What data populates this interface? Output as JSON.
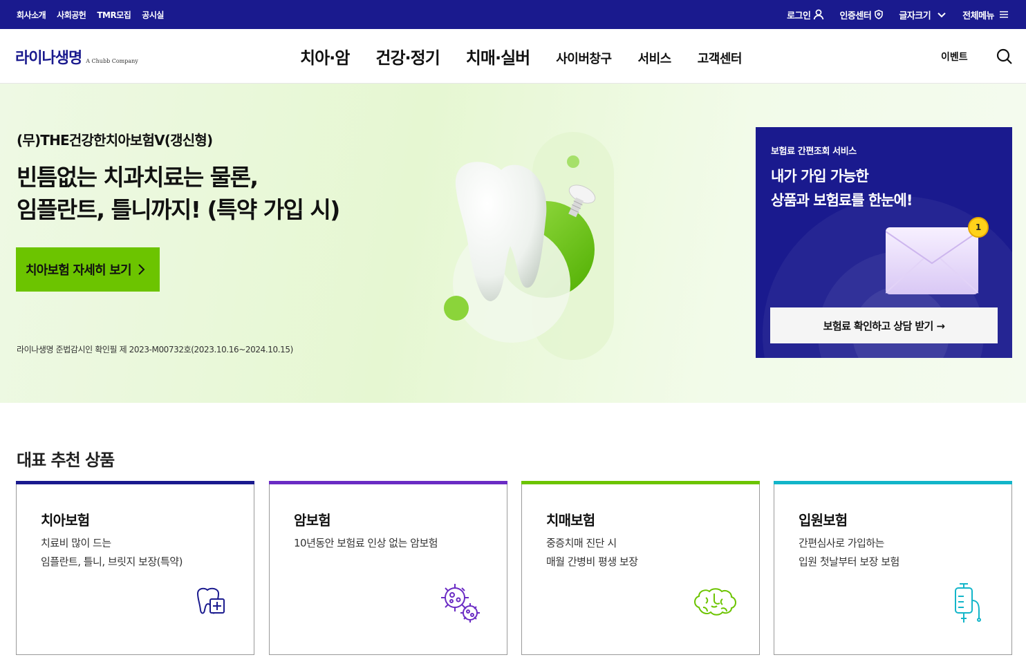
{
  "topbar": {
    "links": [
      "회사소개",
      "사회공헌",
      "TMR모집",
      "공시실"
    ],
    "login": "로그인",
    "auth_center": "인증센터",
    "font_size": "글자크기",
    "full_menu": "전체메뉴"
  },
  "header": {
    "logo": "라이나생명",
    "logo_sub": "A Chubb Company",
    "nav_big": [
      "치아·암",
      "건강·정기",
      "치매·실버"
    ],
    "nav_small": [
      "사이버창구",
      "서비스",
      "고객센터"
    ],
    "event": "이벤트"
  },
  "hero": {
    "product": "(무)THE건강한치아보험V(갱신형)",
    "title_line1": "빈틈없는 치과치료는 물론,",
    "title_line2": "임플란트, 틀니까지! (특약 가입 시)",
    "cta": "치아보험 자세히 보기",
    "note": "라이나생명 준법감시인 확인필 제 2023-M00732호(2023.10.16~2024.10.15)"
  },
  "panel": {
    "label": "보험료 간편조회 서비스",
    "title_line1": "내가 가입 가능한",
    "title_line2": "상품과 보험료를 한눈에!",
    "badge": "1",
    "button": "보험료 확인하고 상담 받기 →"
  },
  "section": {
    "title": "대표 추천 상품",
    "cards": [
      {
        "title": "치아보험",
        "line1": "치료비 많이 드는",
        "line2": "임플란트, 틀니, 브릿지 보장(특약)",
        "icon": "tooth-icon",
        "color": "#1a1a8e"
      },
      {
        "title": "암보험",
        "line1": "10년동안 보험료 인상 없는 암보험",
        "line2": "",
        "icon": "virus-icon",
        "color": "#6a2bc4"
      },
      {
        "title": "치매보험",
        "line1": "중증치매 진단 시",
        "line2": "매월 간병비 평생 보장",
        "icon": "brain-icon",
        "color": "#6cc400"
      },
      {
        "title": "입원보험",
        "line1": "간편심사로 가입하는",
        "line2": "입원 첫날부터 보장 보험",
        "icon": "iv-drip-icon",
        "color": "#12b5c9"
      }
    ]
  }
}
